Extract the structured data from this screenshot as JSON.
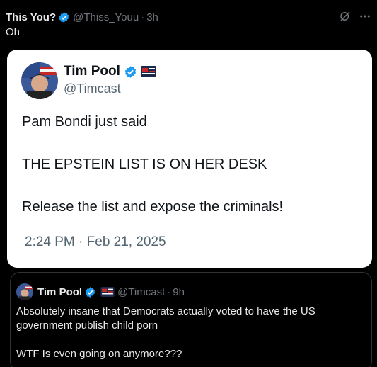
{
  "post": {
    "author_name": "This You?",
    "handle": "@Thiss_Youu",
    "dot": "·",
    "time": "3h",
    "text": "Oh"
  },
  "image": {
    "author_name": "Tim Pool",
    "handle": "@Timcast",
    "line1": "Pam Bondi just said",
    "line2": "THE EPSTEIN LIST IS ON HER DESK",
    "line3": "Release the list and expose the criminals!",
    "timestamp": "2:24 PM · Feb 21, 2025"
  },
  "quote": {
    "author_name": "Tim Pool",
    "handle": "@Timcast",
    "dot": "·",
    "time": "9h",
    "line1": "Absolutely insane that Democrats actually voted to have the US government publish child porn",
    "line2": "WTF Is even going on anymore???"
  },
  "colors": {
    "background": "#000000",
    "verified_blue": "#1d9bf0",
    "muted_text": "#71767b",
    "card_white": "#ffffff"
  },
  "icons": [
    "verified-icon",
    "grok-icon",
    "more-icon",
    "flag-badge-icon"
  ]
}
